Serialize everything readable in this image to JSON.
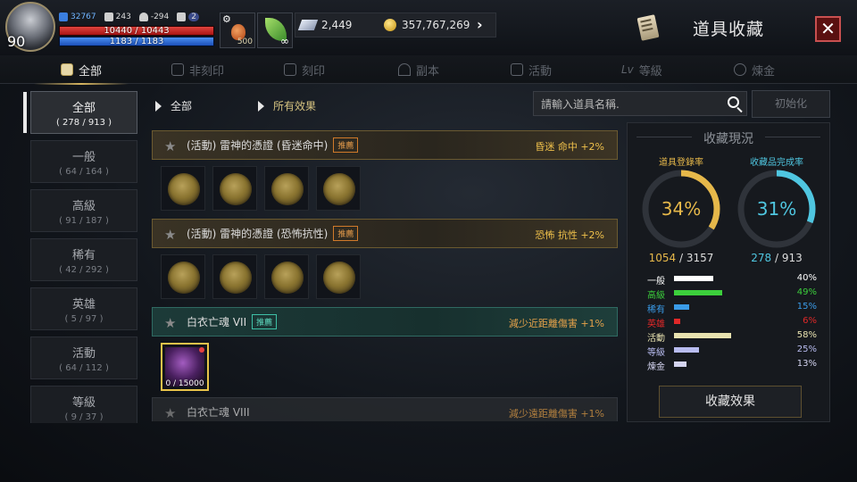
{
  "player": {
    "level": "90",
    "power": "32767",
    "stat2": "243",
    "stat3": "-294",
    "stat4": "2",
    "hp_text": "10440 / 10443",
    "hp_fraction": 0.9997,
    "mp_text": "1183 / 1183",
    "mp_fraction": 1.0
  },
  "quick_slots": {
    "potion_count": "500"
  },
  "currencies": {
    "crystal": "2,449",
    "gold": "357,767,269"
  },
  "title": "道具收藏",
  "close_symbol": "✕",
  "tabs": [
    {
      "label": "全部"
    },
    {
      "label": "非刻印"
    },
    {
      "label": "刻印"
    },
    {
      "label": "副本"
    },
    {
      "label": "活動"
    },
    {
      "label": "等級"
    },
    {
      "label": "煉金"
    }
  ],
  "sidebar": [
    {
      "name": "全部",
      "count": "( 278 / 913 )"
    },
    {
      "name": "一般",
      "count": "( 64 / 164 )"
    },
    {
      "name": "高級",
      "count": "( 91 / 187 )"
    },
    {
      "name": "稀有",
      "count": "( 42 / 292 )"
    },
    {
      "name": "英雄",
      "count": "( 5 / 97 )"
    },
    {
      "name": "活動",
      "count": "( 64 / 112 )"
    },
    {
      "name": "等級",
      "count": "( 9 / 37 )"
    }
  ],
  "filters": {
    "category": "全部",
    "effect": "所有效果"
  },
  "search": {
    "placeholder": "請輸入道具名稱."
  },
  "reset_label": "初始化",
  "items": [
    {
      "name": "(活動) 雷神的憑證 (昏迷命中)",
      "badge": "推薦",
      "effect": "昏迷 命中 +2%"
    },
    {
      "name": "(活動) 雷神的憑證 (恐怖抗性)",
      "badge": "推薦",
      "effect": "恐怖 抗性 +2%"
    },
    {
      "name": "白衣亡魂 VII",
      "badge": "推薦",
      "effect": "減少近距離傷害 +1%",
      "progress": "0 / 15000"
    },
    {
      "name": "白衣亡魂 VIII",
      "effect": "減少遠距離傷害 +1%"
    }
  ],
  "panel": {
    "title": "收藏現況",
    "registration_label": "道具登錄率",
    "completion_label": "收藏品完成率",
    "registration_pct": "34%",
    "registration_value": 34,
    "completion_pct": "31%",
    "completion_value": 31,
    "registration_have": "1054",
    "registration_total": "/ 3157",
    "completion_have": "278",
    "completion_total": "/ 913",
    "breakdown": [
      {
        "label": "一般",
        "value": "40%",
        "fraction": 0.4,
        "color": "#ffffff"
      },
      {
        "label": "高級",
        "value": "49%",
        "fraction": 0.49,
        "color": "#3ccf3c"
      },
      {
        "label": "稀有",
        "value": "15%",
        "fraction": 0.15,
        "color": "#3a9be8"
      },
      {
        "label": "英雄",
        "value": "6%",
        "fraction": 0.06,
        "color": "#e02828"
      },
      {
        "label": "活動",
        "value": "58%",
        "fraction": 0.58,
        "color": "#e8e2b0"
      },
      {
        "label": "等級",
        "value": "25%",
        "fraction": 0.25,
        "color": "#b8bcf0"
      },
      {
        "label": "煉金",
        "value": "13%",
        "fraction": 0.13,
        "color": "#d4d4f0"
      }
    ],
    "effect_button": "收藏效果"
  },
  "colors": {
    "accent_gold": "#e6b84a",
    "accent_cyan": "#4fc6e0"
  }
}
